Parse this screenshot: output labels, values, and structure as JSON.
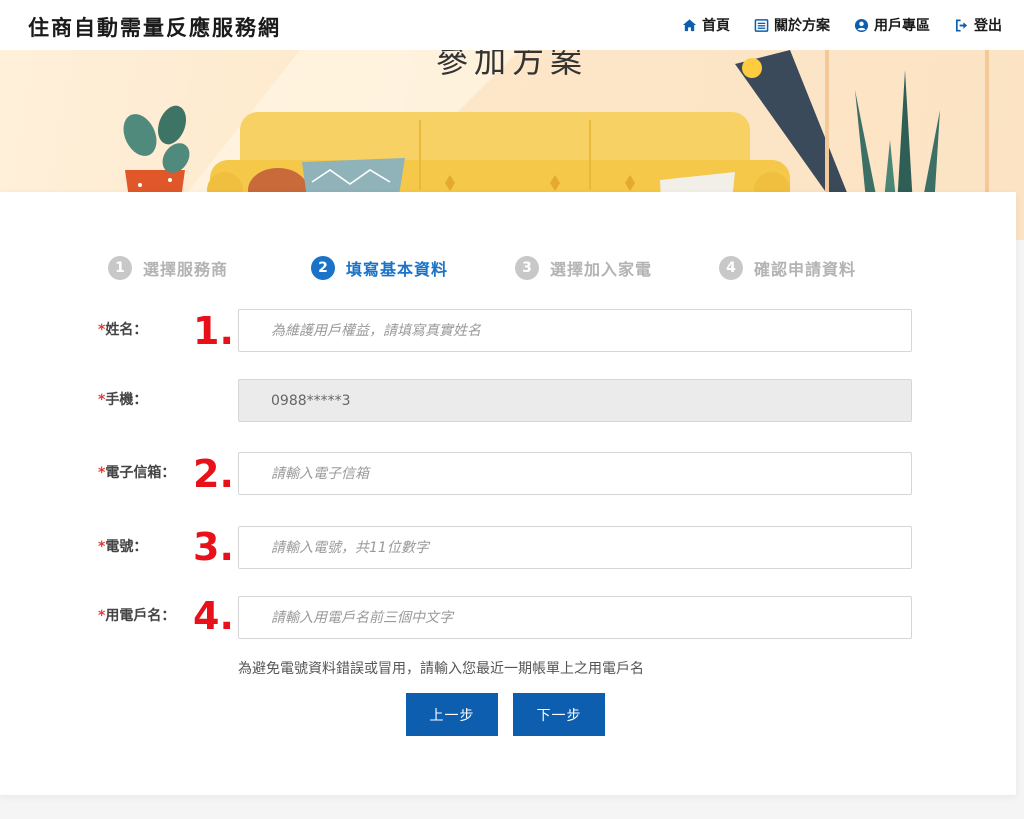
{
  "header": {
    "brand": "住商自動需量反應服務網",
    "nav": [
      {
        "label": "首頁",
        "icon": "home-icon"
      },
      {
        "label": "關於方案",
        "icon": "list-icon"
      },
      {
        "label": "用戶專區",
        "icon": "user-circle-icon"
      },
      {
        "label": "登出",
        "icon": "logout-icon"
      }
    ]
  },
  "banner": {
    "title": "參加方案"
  },
  "steps": [
    {
      "num": "1",
      "label": "選擇服務商",
      "active": false
    },
    {
      "num": "2",
      "label": "填寫基本資料",
      "active": true
    },
    {
      "num": "3",
      "label": "選擇加入家電",
      "active": false
    },
    {
      "num": "4",
      "label": "確認申請資料",
      "active": false
    }
  ],
  "form": {
    "required_mark": "*",
    "name": {
      "label": "姓名：",
      "placeholder": "為維護用戶權益，請填寫真實姓名",
      "value": "",
      "marker": "1."
    },
    "mobile": {
      "label": "手機：",
      "value": "0988*****3",
      "readonly": true
    },
    "email": {
      "label": "電子信箱：",
      "placeholder": "請輸入電子信箱",
      "value": "",
      "marker": "2."
    },
    "meter": {
      "label": "電號：",
      "placeholder": "請輸入電號，共11位數字",
      "value": "",
      "marker": "3."
    },
    "account_name": {
      "label": "用電戶名：",
      "placeholder": "請輸入用電戶名前三個中文字",
      "value": "",
      "marker": "4."
    },
    "hint": "為避免電號資料錯誤或冒用，請輸入您最近一期帳單上之用電戶名"
  },
  "buttons": {
    "prev": "上一步",
    "next": "下一步"
  },
  "colors": {
    "accent": "#1a73c8",
    "button": "#0d5eae",
    "marker": "#e8111a",
    "required": "#e53935"
  }
}
